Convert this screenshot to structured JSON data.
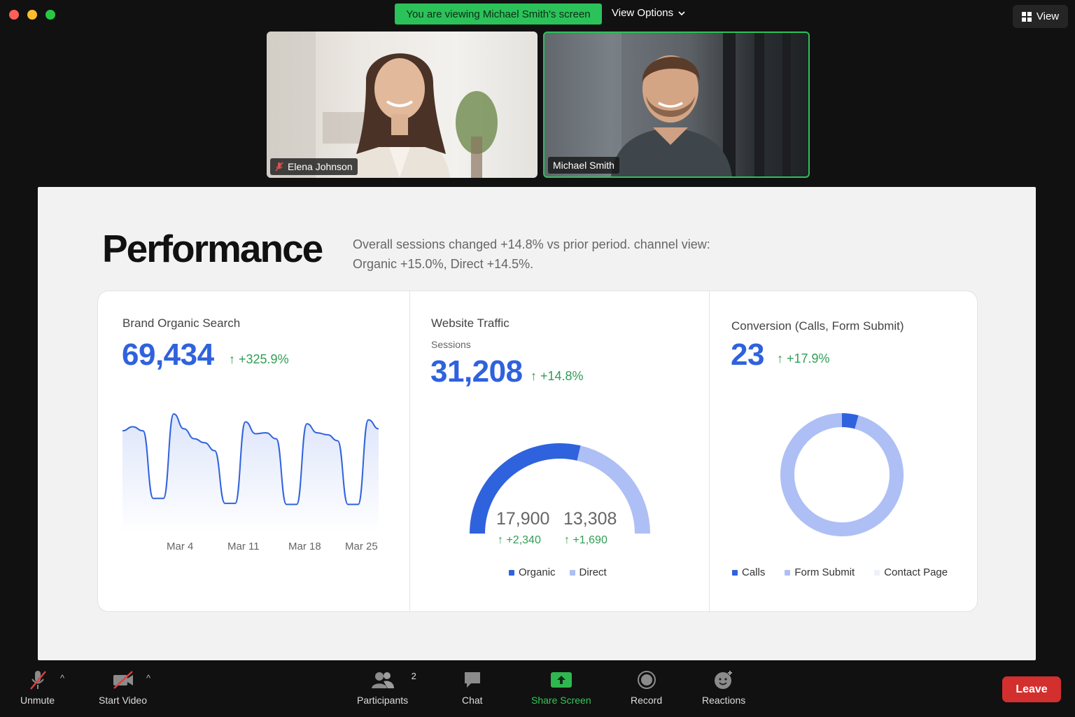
{
  "meeting": {
    "banner": "You are viewing Michael Smith's screen",
    "view_options": "View Options",
    "view": "View"
  },
  "participants": [
    {
      "name": "Elena Johnson",
      "muted": true
    },
    {
      "name": "Michael Smith",
      "muted": false,
      "active_speaker": true
    }
  ],
  "slide": {
    "title": "Performance",
    "summary_line1": "Overall sessions changed +14.8% vs prior period. channel view:",
    "summary_line2": "Organic +15.0%, Direct +14.5%.",
    "panels": {
      "brand": {
        "title": "Brand Organic Search",
        "value": "69,434",
        "delta": "+325.9%"
      },
      "traffic": {
        "title": "Website Traffic",
        "subtitle": "Sessions",
        "value": "31,208",
        "delta": "+14.8%",
        "organic_value": "17,900",
        "organic_delta": "+2,340",
        "direct_value": "13,308",
        "direct_delta": "+1,690"
      },
      "conversion": {
        "title": "Conversion (Calls, Form Submit)",
        "value": "23",
        "delta": "+17.9%"
      }
    }
  },
  "chart_data": [
    {
      "type": "area",
      "title": "Brand Organic Search",
      "x_ticks": [
        "Mar 4",
        "Mar 11",
        "Mar 18",
        "Mar 25"
      ],
      "values": [
        0.78,
        0.82,
        0.78,
        0.1,
        0.1,
        0.95,
        0.8,
        0.7,
        0.66,
        0.58,
        0.05,
        0.05,
        0.87,
        0.75,
        0.76,
        0.7,
        0.04,
        0.04,
        0.85,
        0.76,
        0.74,
        0.68,
        0.04,
        0.04,
        0.89,
        0.8
      ]
    },
    {
      "type": "pie",
      "title": "Website Traffic",
      "series": [
        {
          "name": "Organic",
          "value": 17900
        },
        {
          "name": "Direct",
          "value": 13308
        }
      ],
      "legend": [
        "Organic",
        "Direct"
      ]
    },
    {
      "type": "pie",
      "title": "Conversion (Calls, Form Submit)",
      "series": [
        {
          "name": "Calls",
          "value": 1
        },
        {
          "name": "Form Submit",
          "value": 22
        },
        {
          "name": "Contact Page",
          "value": 0
        }
      ],
      "legend": [
        "Calls",
        "Form Submit",
        "Contact Page"
      ]
    }
  ],
  "colors": {
    "primary": "#2f62dd",
    "light": "#aebff5",
    "faint": "#eef1fb",
    "positive": "#2f9e55",
    "leave": "#d32f2f",
    "speaker": "#2bc25a"
  },
  "toolbar": {
    "unmute": "Unmute",
    "start_video": "Start Video",
    "participants": "Participants",
    "participants_count": "2",
    "chat": "Chat",
    "share_screen": "Share Screen",
    "record": "Record",
    "reactions": "Reactions",
    "leave": "Leave"
  }
}
